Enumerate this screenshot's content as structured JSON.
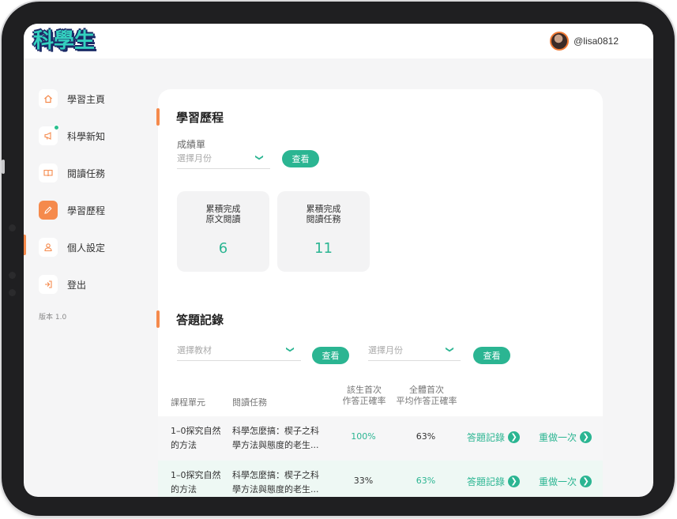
{
  "app": {
    "logo": "科學生",
    "username": "@lisa0812"
  },
  "sidebar": {
    "items": [
      {
        "label": "學習主頁",
        "icon": "home-icon"
      },
      {
        "label": "科學新知",
        "icon": "megaphone-icon",
        "has_badge": true
      },
      {
        "label": "閱讀任務",
        "icon": "book-icon"
      },
      {
        "label": "學習歷程",
        "icon": "pencil-icon",
        "active": true
      },
      {
        "label": "個人設定",
        "icon": "user-icon"
      },
      {
        "label": "登出",
        "icon": "logout-icon"
      }
    ],
    "version": "版本 1.0"
  },
  "learning": {
    "title": "學習歷程",
    "report_label": "成績單",
    "month_placeholder": "選擇月份",
    "view_label": "查看",
    "stats": [
      {
        "line1": "累積完成",
        "line2": "原文閱讀",
        "value": "6"
      },
      {
        "line1": "累積完成",
        "line2": "閱讀任務",
        "value": "11"
      }
    ]
  },
  "answers": {
    "title": "答題記錄",
    "material_placeholder": "選擇教材",
    "month_placeholder": "選擇月份",
    "view_label": "查看",
    "columns": {
      "unit": "課程單元",
      "task": "閱讀任務",
      "student_line1": "該生首次",
      "student_line2": "作答正確率",
      "all_line1": "全體首次",
      "all_line2": "平均作答正確率"
    },
    "rows": [
      {
        "unit_line1": "1–0探究自然",
        "unit_line2": "的方法",
        "task_line1": "科學怎麼搞：楔子之科",
        "task_line2": "學方法與態度的老生...",
        "student": "100%",
        "all": "63%",
        "record": "答題記錄",
        "redo": "重做一次"
      },
      {
        "unit_line1": "1–0探究自然",
        "unit_line2": "的方法",
        "task_line1": "科學怎麼搞：楔子之科",
        "task_line2": "學方法與態度的老生...",
        "student": "33%",
        "all": "63%",
        "record": "答題記錄",
        "redo": "重做一次"
      }
    ]
  },
  "colors": {
    "accent_orange": "#f58a4c",
    "accent_green": "#2bb592",
    "logo_teal": "#34d1bf",
    "logo_navy": "#1a2a66"
  }
}
